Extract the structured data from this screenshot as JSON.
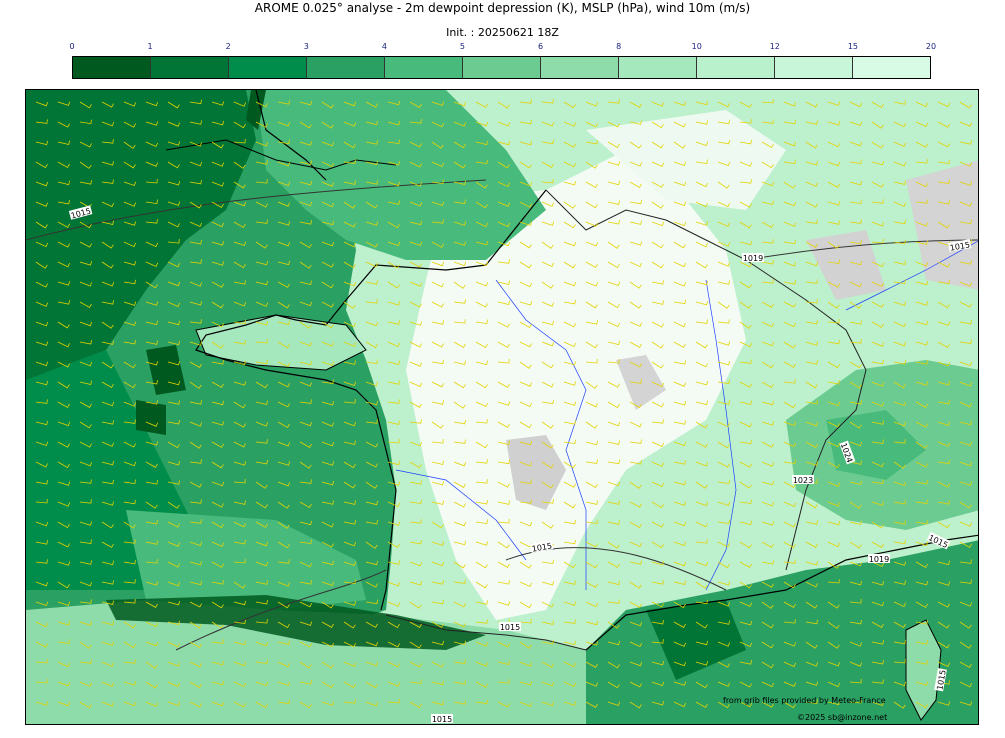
{
  "title": "AROME 0.025° analyse - 2m dewpoint depression (K), MSLP (hPa), wind 10m (m/s)",
  "subtitle": "Init. : 20250621 18Z",
  "colorbar": {
    "ticks": [
      "0",
      "1",
      "2",
      "3",
      "4",
      "5",
      "6",
      "8",
      "10",
      "12",
      "15",
      "20"
    ],
    "colors": [
      "#00591f",
      "#007535",
      "#008c4a",
      "#2aa063",
      "#48bb7c",
      "#6ccb91",
      "#8fdcab",
      "#a5e8bd",
      "#b9f1cd",
      "#c8f6d9",
      "#d8fbe6"
    ]
  },
  "map": {
    "isobar_labels": [
      {
        "id": "l1",
        "text": "1015"
      },
      {
        "id": "l2",
        "text": "1019"
      },
      {
        "id": "l3",
        "text": "1015"
      },
      {
        "id": "l4",
        "text": "1024"
      },
      {
        "id": "l5",
        "text": "1023"
      },
      {
        "id": "l6",
        "text": "1015"
      },
      {
        "id": "l7",
        "text": "1019"
      },
      {
        "id": "l8",
        "text": "1015"
      },
      {
        "id": "l9",
        "text": "1015"
      },
      {
        "id": "l10",
        "text": "1015"
      },
      {
        "id": "l11",
        "text": "1015"
      }
    ]
  },
  "credits": {
    "source": "from grib files provided by Meteo-France",
    "copyright": "©2025 sb@inzone.net"
  }
}
